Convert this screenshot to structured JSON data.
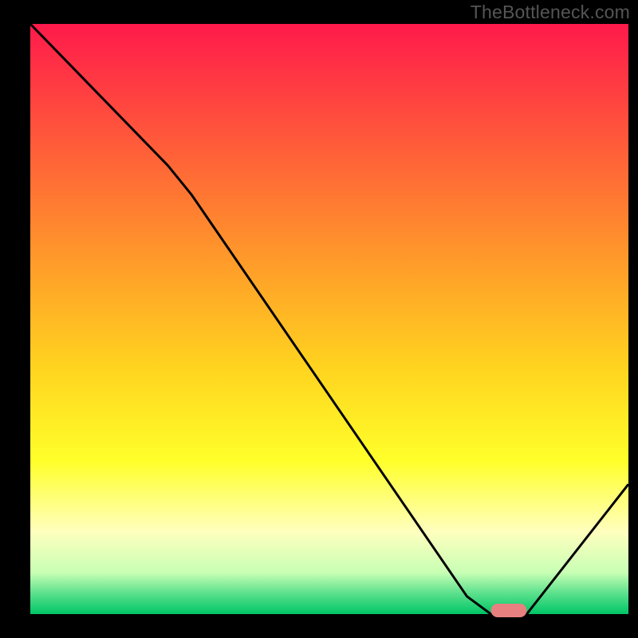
{
  "watermark": "TheBottleneck.com",
  "chart_data": {
    "type": "line",
    "title": "",
    "xlabel": "",
    "ylabel": "",
    "xlim": [
      0,
      100
    ],
    "ylim": [
      0,
      100
    ],
    "grid": false,
    "legend": false,
    "gradient_stops": [
      {
        "offset": 0.0,
        "color": "#ff1a4b"
      },
      {
        "offset": 0.2,
        "color": "#ff5a3a"
      },
      {
        "offset": 0.4,
        "color": "#ff9a2a"
      },
      {
        "offset": 0.58,
        "color": "#ffd31f"
      },
      {
        "offset": 0.74,
        "color": "#ffff2a"
      },
      {
        "offset": 0.86,
        "color": "#ffffbe"
      },
      {
        "offset": 0.93,
        "color": "#c8ffb4"
      },
      {
        "offset": 0.965,
        "color": "#5be08c"
      },
      {
        "offset": 1.0,
        "color": "#00c566"
      }
    ],
    "series": [
      {
        "name": "bottleneck-curve",
        "color": "#000000",
        "x": [
          0,
          23,
          27,
          73,
          77,
          83,
          100
        ],
        "y": [
          100,
          76,
          71,
          3,
          0,
          0,
          22
        ]
      }
    ],
    "marker": {
      "name": "optimal-range",
      "color": "#e98080",
      "x": [
        77,
        83
      ],
      "y": 0.6,
      "thickness": 2.3
    }
  }
}
